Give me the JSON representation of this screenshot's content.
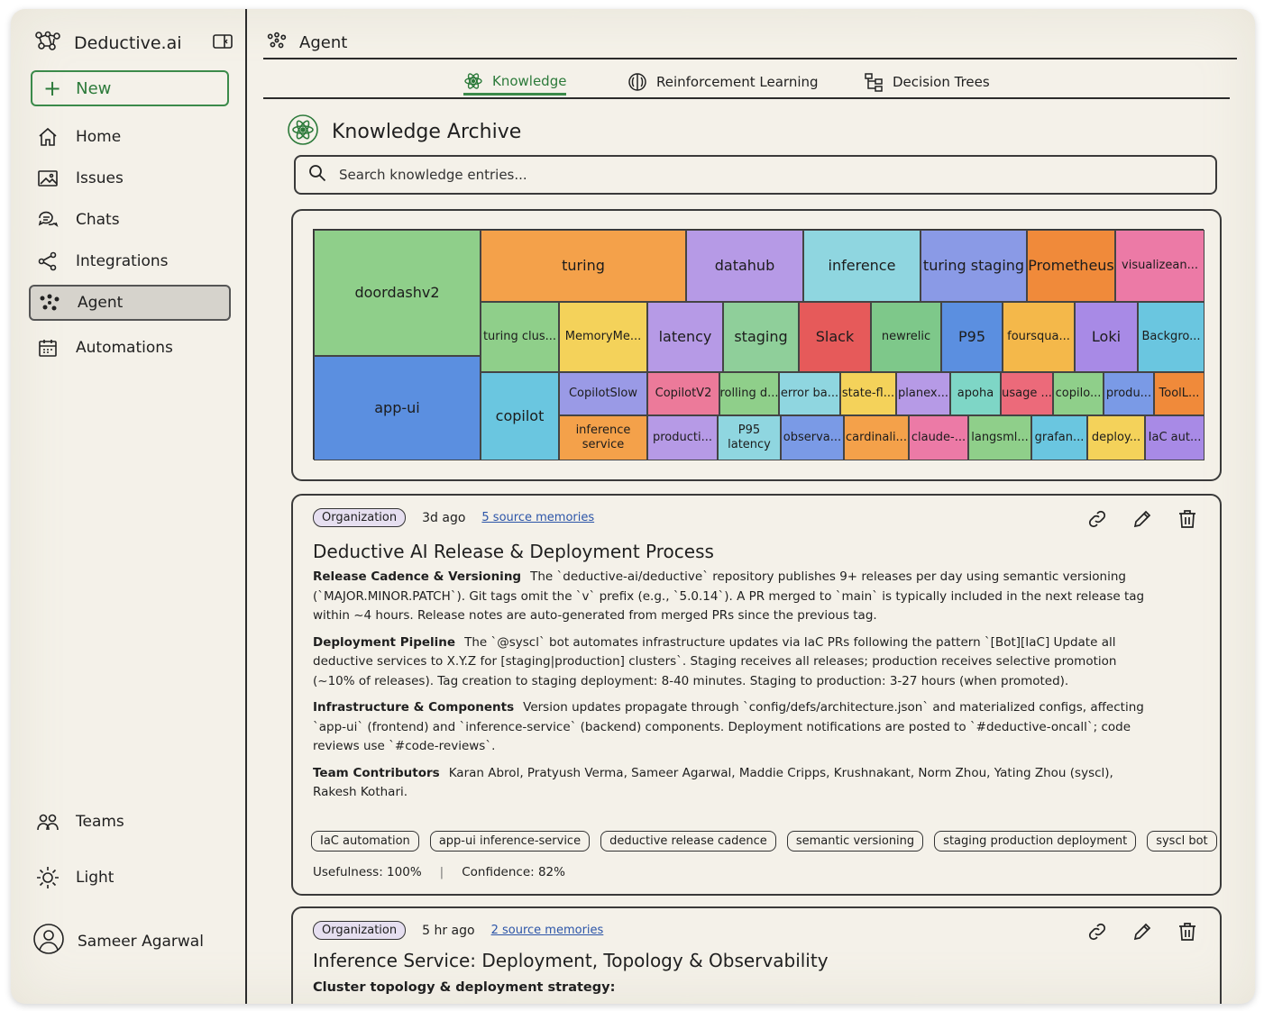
{
  "app": {
    "name": "Deductive.ai"
  },
  "sidebar": {
    "new_label": "New",
    "items": [
      {
        "label": "Home",
        "icon": "home-icon"
      },
      {
        "label": "Issues",
        "icon": "image-icon"
      },
      {
        "label": "Chats",
        "icon": "chats-icon"
      },
      {
        "label": "Integrations",
        "icon": "share-icon"
      },
      {
        "label": "Agent",
        "icon": "agent-icon",
        "active": true
      },
      {
        "label": "Automations",
        "icon": "calendar-icon"
      }
    ],
    "bottom": [
      {
        "label": "Teams",
        "icon": "users-icon"
      },
      {
        "label": "Light",
        "icon": "sun-icon"
      }
    ],
    "user": "Sameer Agarwal"
  },
  "header": {
    "title": "Agent"
  },
  "tabs": [
    {
      "label": "Knowledge",
      "active": true
    },
    {
      "label": "Reinforcement Learning"
    },
    {
      "label": "Decision Trees"
    }
  ],
  "archive": {
    "title": "Knowledge Archive",
    "search_placeholder": "Search knowledge entries..."
  },
  "treemap": [
    {
      "label": "doordashv2",
      "color": "#8fcf8a"
    },
    {
      "label": "app-ui",
      "color": "#5b8fe0"
    },
    {
      "label": "turing",
      "color": "#f4a14a"
    },
    {
      "label": "datahub",
      "color": "#b69ae6"
    },
    {
      "label": "inference",
      "color": "#8fd6e0"
    },
    {
      "label": "turing staging",
      "color": "#8a9ae6"
    },
    {
      "label": "Prometheus",
      "color": "#f08a3a"
    },
    {
      "label": "visualizean...",
      "color": "#ec7aa6"
    },
    {
      "label": "turing clus...",
      "color": "#8fcf8a"
    },
    {
      "label": "MemoryMe...",
      "color": "#f4d25a"
    },
    {
      "label": "latency",
      "color": "#b69ae6"
    },
    {
      "label": "staging",
      "color": "#8fcf9a"
    },
    {
      "label": "Slack",
      "color": "#e65a5a"
    },
    {
      "label": "newrelic",
      "color": "#7ec88a"
    },
    {
      "label": "P95",
      "color": "#5b8fe0"
    },
    {
      "label": "foursqua...",
      "color": "#f4b84a"
    },
    {
      "label": "Loki",
      "color": "#a88ae6"
    },
    {
      "label": "Backgro...",
      "color": "#6ac6e0"
    },
    {
      "label": "copilot",
      "color": "#6ac6e0"
    },
    {
      "label": "CopilotSlow",
      "color": "#9a9ae6"
    },
    {
      "label": "CopilotV2",
      "color": "#ec7a9a"
    },
    {
      "label": "rolling d...",
      "color": "#8fcf8a"
    },
    {
      "label": "error ba...",
      "color": "#8fd6e0"
    },
    {
      "label": "state-fl...",
      "color": "#f4d25a"
    },
    {
      "label": "planex...",
      "color": "#b69ae6"
    },
    {
      "label": "apoha",
      "color": "#7ed6c6"
    },
    {
      "label": "usage ...",
      "color": "#ec6a7a"
    },
    {
      "label": "copilo...",
      "color": "#8fcf8a"
    },
    {
      "label": "produ...",
      "color": "#7a9ae6"
    },
    {
      "label": "ToolL...",
      "color": "#f08a3a"
    },
    {
      "label": "inference service",
      "color": "#f4a14a"
    },
    {
      "label": "producti...",
      "color": "#b69ae6"
    },
    {
      "label": "P95 latency",
      "color": "#8fd6e0"
    },
    {
      "label": "observa...",
      "color": "#7a9ae6"
    },
    {
      "label": "cardinali...",
      "color": "#f4a14a"
    },
    {
      "label": "claude-...",
      "color": "#ec7aa6"
    },
    {
      "label": "langsml...",
      "color": "#8fcf8a"
    },
    {
      "label": "grafan...",
      "color": "#6ac6e0"
    },
    {
      "label": "deploy...",
      "color": "#f4d25a"
    },
    {
      "label": "IaC aut...",
      "color": "#a88ae6"
    }
  ],
  "memories": [
    {
      "badge": "Organization",
      "ago": "3d ago",
      "sources": "5 source memories",
      "title": "Deductive AI Release & Deployment Process",
      "sections": [
        {
          "heading": "Release Cadence & Versioning",
          "text": "The `deductive-ai/deductive` repository publishes 9+ releases per day using semantic versioning (`MAJOR.MINOR.PATCH`). Git tags omit the `v` prefix (e.g., `5.0.14`). A PR merged to `main` is typically included in the next release tag within ~4 hours. Release notes are auto-generated from merged PRs since the previous tag."
        },
        {
          "heading": "Deployment Pipeline",
          "text": "The `@syscl` bot automates infrastructure updates via IaC PRs following the pattern `[Bot][IaC] Update all deductive services to X.Y.Z for [staging|production] clusters`. Staging receives all releases; production receives selective promotion (~10% of releases). Tag creation to staging deployment: 8-40 minutes. Staging to production: 3-27 hours (when promoted)."
        },
        {
          "heading": "Infrastructure & Components",
          "text": "Version updates propagate through `config/defs/architecture.json` and materialized configs, affecting `app-ui` (frontend) and `inference-service` (backend) components. Deployment notifications are posted to `#deductive-oncall`; code reviews use `#code-reviews`."
        },
        {
          "heading": "Team Contributors",
          "text": "Karan Abrol, Pratyush Verma, Sameer Agarwal, Maddie Cripps, Krushnakant, Norm Zhou, Yating Zhou (syscl), Rakesh Kothari."
        }
      ],
      "tags": [
        "IaC automation",
        "app-ui inference-service",
        "deductive release cadence",
        "semantic versioning",
        "staging production deployment",
        "syscl bot"
      ],
      "usefulness": "Usefulness: 100%",
      "confidence": "Confidence: 82%"
    },
    {
      "badge": "Organization",
      "ago": "5 hr ago",
      "sources": "2 source memories",
      "title": "Inference Service: Deployment, Topology & Observability",
      "first_heading": "Cluster topology & deployment strategy:"
    }
  ],
  "colors": {
    "accent": "#2c7a3a",
    "link": "#2c55a8",
    "paper": "#f4f1e9",
    "badge": "#e6dff0"
  }
}
